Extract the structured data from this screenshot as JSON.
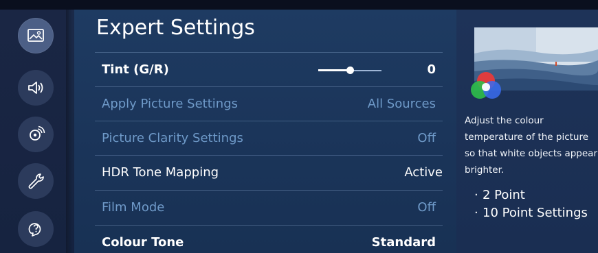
{
  "colors": {
    "menu_bg": "#1e3b62",
    "rail_bg": "#1a2644",
    "dim_text": "#6f9ac9",
    "bright_text": "#ffffff"
  },
  "sidebar": {
    "items": [
      {
        "icon": "picture-icon",
        "active": true
      },
      {
        "icon": "sound-icon",
        "active": false
      },
      {
        "icon": "broadcast-icon",
        "active": false
      },
      {
        "icon": "support-wrench-icon",
        "active": false
      },
      {
        "icon": "help-icon",
        "active": false
      }
    ]
  },
  "menu": {
    "title": "Expert Settings",
    "rows": [
      {
        "label": "Tint (G/R)",
        "value": "0",
        "slider_fraction": 0.5,
        "state": "selected"
      },
      {
        "label": "Apply Picture Settings",
        "value": "All Sources",
        "state": "disabled"
      },
      {
        "label": "Picture Clarity Settings",
        "value": "Off",
        "state": "disabled"
      },
      {
        "label": "HDR Tone Mapping",
        "value": "Active",
        "state": "enabled"
      },
      {
        "label": "Film Mode",
        "value": "Off",
        "state": "disabled"
      },
      {
        "label": "Colour Tone",
        "value": "Standard",
        "state": "selected"
      }
    ]
  },
  "info": {
    "description_lines": [
      "Adjust the colour",
      "temperature of the picture",
      "so that white objects appear",
      "brighter."
    ],
    "options": [
      "2 Point",
      "10 Point Settings"
    ],
    "option_bullet": "·"
  }
}
